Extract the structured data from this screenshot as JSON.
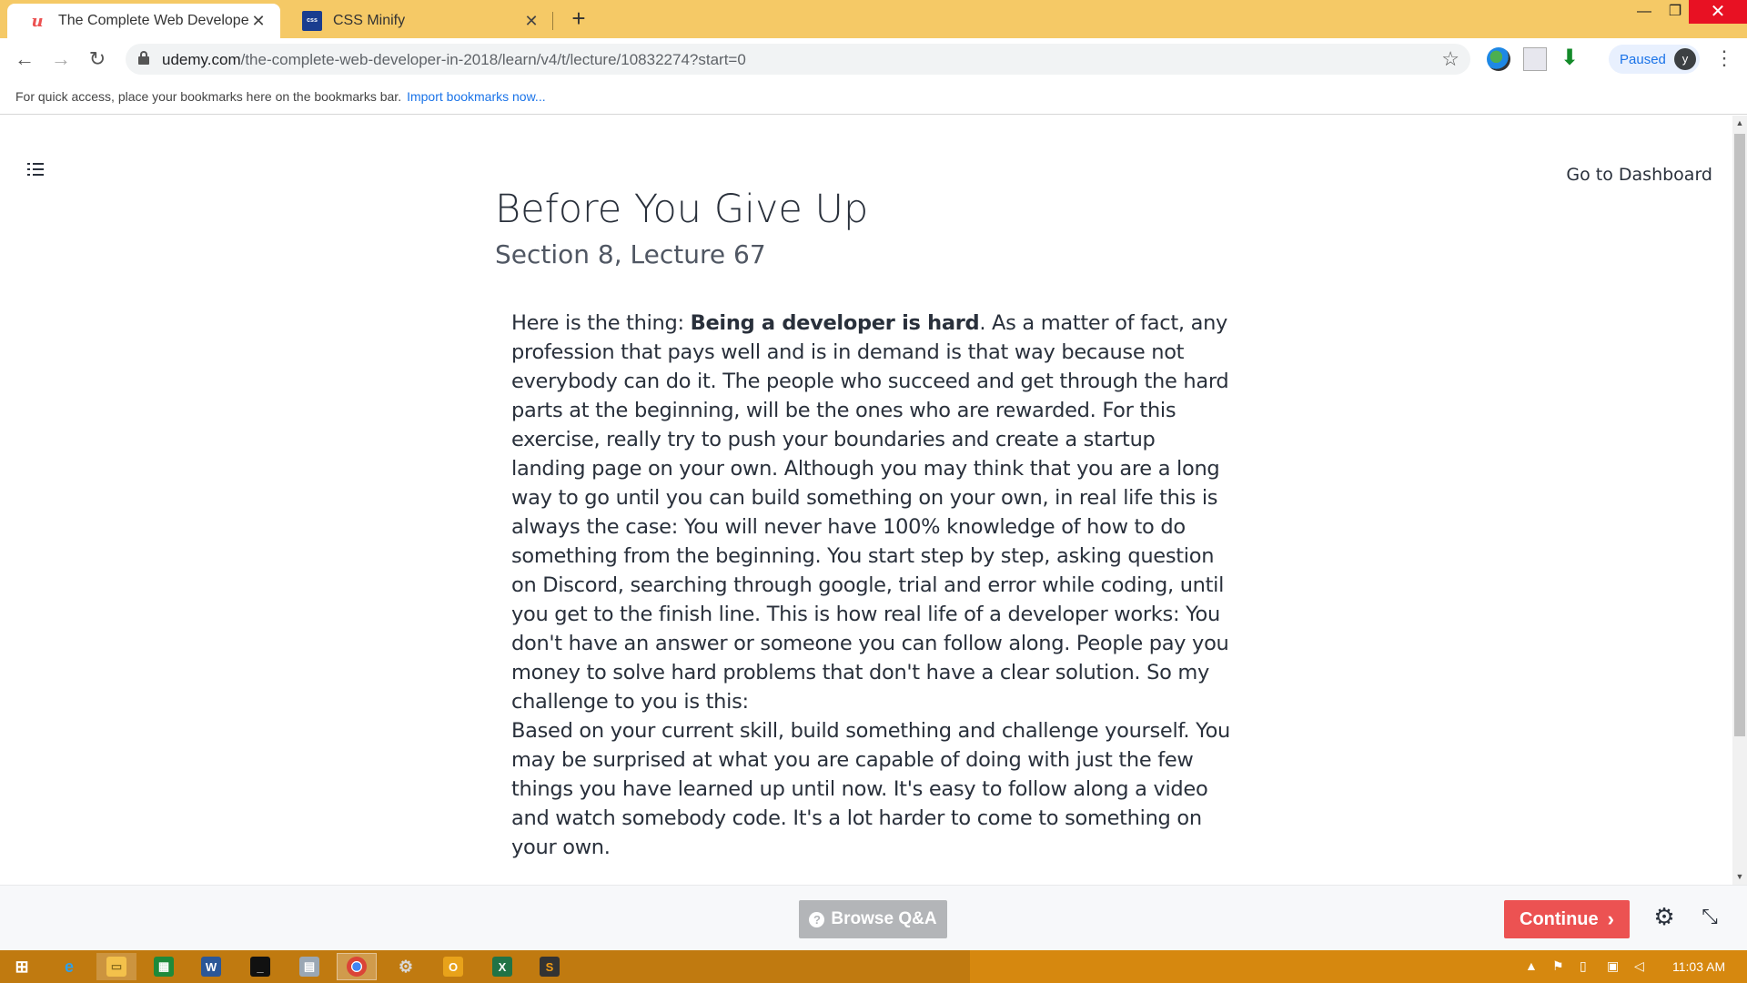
{
  "browser": {
    "tabs": [
      {
        "title": "The Complete Web Developer in",
        "favicon": "udemy-icon",
        "active": true
      },
      {
        "title": "CSS Minify",
        "favicon": "css-minify-icon",
        "active": false
      }
    ],
    "url_host": "udemy.com",
    "url_path": "/the-complete-web-developer-in-2018/learn/v4/t/lecture/10832274?start=0",
    "profile_status": "Paused",
    "profile_initial": "y",
    "bookmarks_hint": "For quick access, place your bookmarks here on the bookmarks bar.",
    "bookmarks_link": "Import bookmarks now..."
  },
  "lecture": {
    "dashboard_link": "Go to Dashboard",
    "title": "Before You Give Up",
    "subtitle": "Section 8, Lecture 67",
    "intro_prefix": "Here is the thing: ",
    "intro_bold": "Being a developer is hard",
    "intro_rest": ". As a matter of fact, any profession that pays well and is in demand is that way because not everybody can do it. The people who succeed and get through the hard parts at the beginning, will be the ones who are rewarded. For this exercise, really try to push your boundaries and create a startup landing page on your own. Although you may think that you are a long way to go until you can build something on your own, in real life this is always the case: You will never have 100% knowledge of how to do something from the beginning. You start step by step, asking question on Discord, searching through google, trial and error while coding, until you get to the finish line. This is how real life of a developer works: You don't have an answer or someone you can follow along. People pay you money to solve hard problems that don't have a clear solution. So my challenge to you is this:",
    "paragraph_2": "Based on your current skill, build something and challenge yourself. You may be surprised at what you are capable of doing with just the few things you have learned up until now. It's easy to follow along a video and watch somebody code. It's a lot harder to come to something on your own."
  },
  "footer": {
    "browse_qa": "Browse Q&A",
    "continue": "Continue"
  },
  "taskbar": {
    "apps": [
      "start-icon",
      "internet-explorer-icon",
      "file-explorer-icon",
      "store-icon",
      "word-icon",
      "terminal-icon",
      "app-icon",
      "chrome-icon",
      "settings-app-icon",
      "outlook-icon",
      "excel-icon",
      "sublime-icon"
    ],
    "clock": "11:03 AM"
  },
  "colors": {
    "tabstrip": "#f5c966",
    "accent": "#ec5252",
    "link": "#1a73e8",
    "taskbar": "#d6880f"
  }
}
